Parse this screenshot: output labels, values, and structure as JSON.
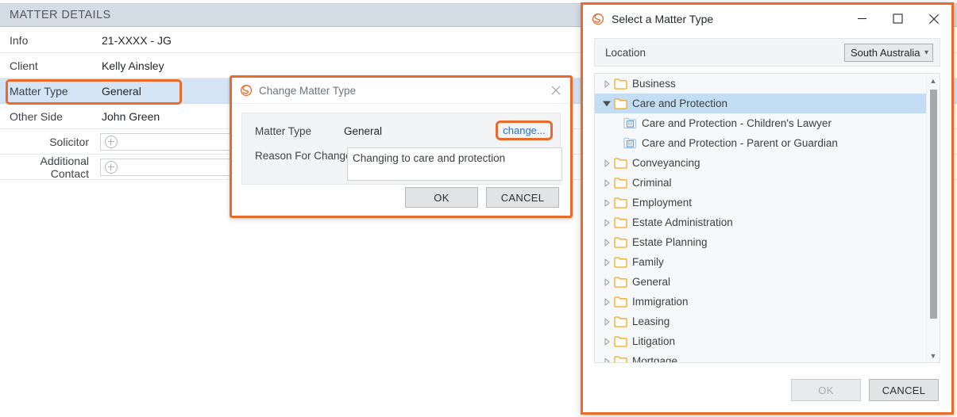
{
  "background": {
    "panel_title": "MATTER DETAILS",
    "rows": [
      {
        "label": "Info",
        "value": "21-XXXX - JG",
        "type": "text",
        "indent": false,
        "highlighted": false
      },
      {
        "label": "Client",
        "value": "Kelly Ainsley",
        "type": "text",
        "indent": false,
        "highlighted": false
      },
      {
        "label": "Matter Type",
        "value": "General",
        "type": "text",
        "indent": false,
        "highlighted": true
      },
      {
        "label": "Other Side",
        "value": "John Green",
        "type": "text",
        "indent": false,
        "highlighted": false
      },
      {
        "label": "Solicitor",
        "value": "",
        "type": "input",
        "indent": true,
        "highlighted": false
      },
      {
        "label": "Additional Contact",
        "value": "",
        "type": "input",
        "indent": true,
        "highlighted": false
      }
    ],
    "add_icon": "plus-circle-icon"
  },
  "change_dialog": {
    "app_icon": "smokeball-swirl-icon",
    "title": "Change Matter Type",
    "close_icon": "close-icon",
    "matter_type_label": "Matter Type",
    "matter_type_value": "General",
    "change_link": "change...",
    "reason_label": "Reason For Change",
    "reason_value": "Changing to care and protection",
    "reason_placeholder": "",
    "ok_label": "OK",
    "cancel_label": "CANCEL"
  },
  "select_window": {
    "app_icon": "smokeball-swirl-icon",
    "title": "Select a Matter Type",
    "minimize_icon": "minimize-icon",
    "maximize_icon": "maximize-icon",
    "close_icon": "close-icon",
    "location_label": "Location",
    "location_value": "South Australia",
    "location_chevron": "chevron-down-icon",
    "tree": [
      {
        "label": "Business",
        "level": 0,
        "expanded": false,
        "selected": false,
        "icon": "folder-icon"
      },
      {
        "label": "Care and Protection",
        "level": 0,
        "expanded": true,
        "selected": true,
        "icon": "folder-icon"
      },
      {
        "label": "Care and Protection - Children's Lawyer",
        "level": 1,
        "expanded": null,
        "selected": false,
        "icon": "matter-type-icon"
      },
      {
        "label": "Care and Protection - Parent or Guardian",
        "level": 1,
        "expanded": null,
        "selected": false,
        "icon": "matter-type-icon"
      },
      {
        "label": "Conveyancing",
        "level": 0,
        "expanded": false,
        "selected": false,
        "icon": "folder-icon"
      },
      {
        "label": "Criminal",
        "level": 0,
        "expanded": false,
        "selected": false,
        "icon": "folder-icon"
      },
      {
        "label": "Employment",
        "level": 0,
        "expanded": false,
        "selected": false,
        "icon": "folder-icon"
      },
      {
        "label": "Estate Administration",
        "level": 0,
        "expanded": false,
        "selected": false,
        "icon": "folder-icon"
      },
      {
        "label": "Estate Planning",
        "level": 0,
        "expanded": false,
        "selected": false,
        "icon": "folder-icon"
      },
      {
        "label": "Family",
        "level": 0,
        "expanded": false,
        "selected": false,
        "icon": "folder-icon"
      },
      {
        "label": "General",
        "level": 0,
        "expanded": false,
        "selected": false,
        "icon": "folder-icon"
      },
      {
        "label": "Immigration",
        "level": 0,
        "expanded": false,
        "selected": false,
        "icon": "folder-icon"
      },
      {
        "label": "Leasing",
        "level": 0,
        "expanded": false,
        "selected": false,
        "icon": "folder-icon"
      },
      {
        "label": "Litigation",
        "level": 0,
        "expanded": false,
        "selected": false,
        "icon": "folder-icon"
      },
      {
        "label": "Mortgage",
        "level": 0,
        "expanded": false,
        "selected": false,
        "icon": "folder-icon"
      }
    ],
    "scrollbar": {
      "up_icon": "scroll-up-icon",
      "down_icon": "scroll-down-icon"
    },
    "ok_label": "OK",
    "ok_disabled": true,
    "cancel_label": "CANCEL"
  },
  "colors": {
    "accent_orange": "#ea6a2a",
    "panel_header": "#d4dce5",
    "row_highlight": "#d6e5f5",
    "tree_selection": "#c3ddf5",
    "link_blue": "#2a6fc9",
    "folder_orange": "#f5a623"
  }
}
